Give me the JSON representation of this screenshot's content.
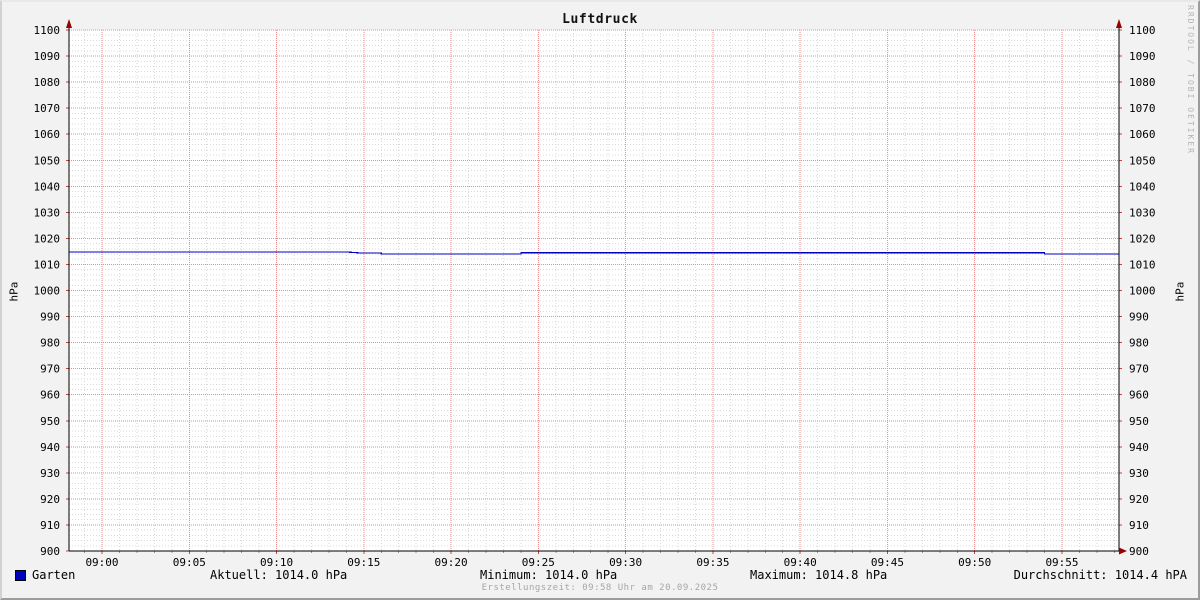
{
  "title": "Luftdruck",
  "watermark": "RRDTOOL / TOBI OETIKER",
  "footer": "Erstellungszeit: 09:58 Uhr am 20.09.2025",
  "axis": {
    "y_label_left": "hPa",
    "y_label_right": "hPa"
  },
  "legend": {
    "series_label": "Garten",
    "series_color": "#0000c0",
    "stats": [
      {
        "label": "Aktuell",
        "value": "1014.0 hPa",
        "text": "Aktuell: 1014.0 hPa"
      },
      {
        "label": "Minimum",
        "value": "1014.0 hPa",
        "text": "Minimum: 1014.0 hPa"
      },
      {
        "label": "Maximum",
        "value": "1014.8 hPa",
        "text": "Maximum: 1014.8 hPa"
      },
      {
        "label": "Durchschnitt",
        "value": "1014.4 hPA",
        "text": "Durchschnitt: 1014.4 hPA"
      }
    ]
  },
  "chart_data": {
    "type": "line",
    "title": "Luftdruck",
    "xlabel": "",
    "ylabel": "hPa",
    "ylim": [
      900,
      1100
    ],
    "y_major_step": 10,
    "y_minor_step": 2,
    "x_ticks": [
      "09:00",
      "09:05",
      "09:10",
      "09:15",
      "09:20",
      "09:25",
      "09:30",
      "09:35",
      "09:40",
      "09:45",
      "09:50",
      "09:55"
    ],
    "x_tick_step_minutes": 5,
    "x_minor_step_minutes": 1,
    "x_range_minutes_rel_0900": [
      -1.9,
      58.3
    ],
    "grid": true,
    "legend_position": "bottom",
    "series": [
      {
        "name": "Garten",
        "unit": "hPa",
        "color": "#0000c0",
        "points": [
          [
            -1.9,
            1014.8
          ],
          [
            14.0,
            1014.8
          ],
          [
            14.8,
            1014.4
          ],
          [
            16.0,
            1014.4
          ],
          [
            16.0,
            1014.0
          ],
          [
            24.0,
            1014.0
          ],
          [
            24.0,
            1014.5
          ],
          [
            54.0,
            1014.5
          ],
          [
            54.0,
            1014.0
          ],
          [
            58.3,
            1014.0
          ]
        ]
      }
    ],
    "stats": {
      "aktuell": 1014.0,
      "minimum": 1014.0,
      "maximum": 1014.8,
      "durchschnitt": 1014.4
    },
    "colors": {
      "canvas_bg": "#f2f2f2",
      "plot_bg": "#ffffff",
      "grid_major": "#eb8d8d",
      "grid_minor": "#d8d8d8",
      "axis": "#000000",
      "arrow": "#990000",
      "tick_major": "#cc4444",
      "tick_minor": "#999999",
      "line": "#0000c0"
    }
  }
}
